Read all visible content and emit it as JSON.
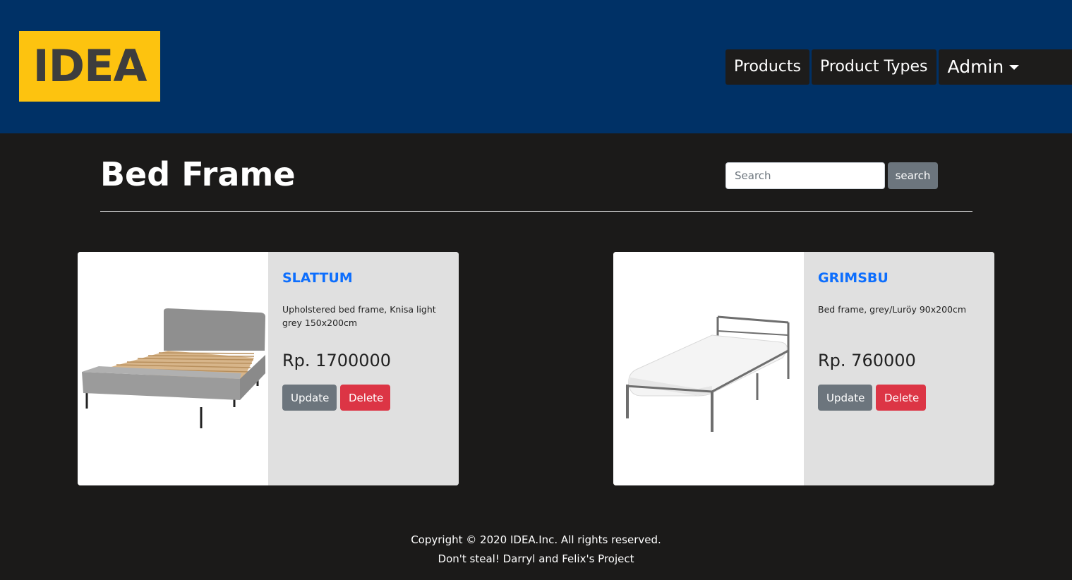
{
  "header": {
    "logo_text": "IDEA",
    "nav": {
      "products": "Products",
      "product_types": "Product Types",
      "admin": "Admin"
    }
  },
  "main": {
    "title": "Bed Frame",
    "search": {
      "placeholder": "Search",
      "button_label": "search"
    },
    "products": [
      {
        "name": "SLATTUM",
        "description": "Upholstered bed frame, Knisa light grey 150x200cm",
        "price": "Rp. 1700000",
        "update_label": "Update",
        "delete_label": "Delete"
      },
      {
        "name": "GRIMSBU",
        "description": "Bed frame, grey/Luröy 90x200cm",
        "price": "Rp. 760000",
        "update_label": "Update",
        "delete_label": "Delete"
      }
    ]
  },
  "footer": {
    "copyright": "Copyright © 2020 IDEA.Inc. All rights reserved.",
    "note": "Don't steal! Darryl and Felix's Project"
  },
  "colors": {
    "header_bg": "#003166",
    "body_bg": "#1b1a19",
    "logo_bg": "#fdc30f",
    "product_name": "#0d6efd",
    "update_button": "#6c757d",
    "delete_button": "#dc3545"
  },
  "icons": [
    "caret-down-icon",
    "bed-image"
  ]
}
